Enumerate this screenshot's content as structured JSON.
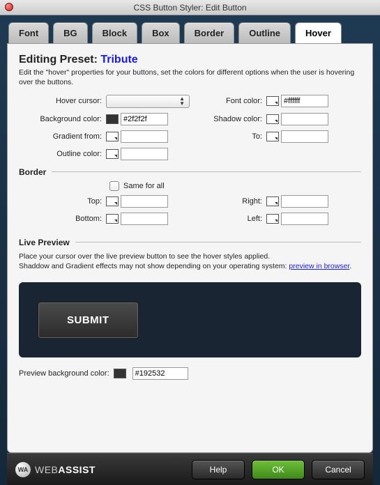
{
  "window": {
    "title": "CSS Button Styler: Edit Button"
  },
  "tabs": [
    "Font",
    "BG",
    "Block",
    "Box",
    "Border",
    "Outline",
    "Hover"
  ],
  "activeTab": "Hover",
  "heading_prefix": "Editing Preset: ",
  "preset_name": "Tribute",
  "description": "Edit the \"hover\" properties for your buttons, set the colors for different options when the user is hovering over the buttons.",
  "labels": {
    "hover_cursor": "Hover cursor:",
    "font_color": "Font color:",
    "bg_color": "Background color:",
    "shadow_color": "Shadow color:",
    "gradient_from": "Gradient from:",
    "gradient_to": "To:",
    "outline_color": "Outline color:",
    "border_section": "Border",
    "same_for_all": "Same for all",
    "top": "Top:",
    "right": "Right:",
    "bottom": "Bottom:",
    "left": "Left:",
    "live_preview": "Live Preview",
    "pbg": "Preview background color:"
  },
  "values": {
    "font_color": "#ffffff",
    "bg_color": "#2f2f2f",
    "shadow_color": "",
    "gradient_from": "",
    "gradient_to": "",
    "outline_color": "",
    "top": "",
    "right": "",
    "bottom": "",
    "left": "",
    "pbg": "#192532"
  },
  "preview_text_1": "Place your cursor over the live preview button to see the hover styles applied.",
  "preview_text_2a": "Shaddow and Gradient effects may not show depending on your operating system: ",
  "preview_link": "preview in browser",
  "submit_label": "SUBMIT",
  "footer": {
    "brand_badge": "WA",
    "brand_html_prefix": "WEB",
    "brand_html_suffix": "ASSIST",
    "help": "Help",
    "ok": "OK",
    "cancel": "Cancel"
  }
}
